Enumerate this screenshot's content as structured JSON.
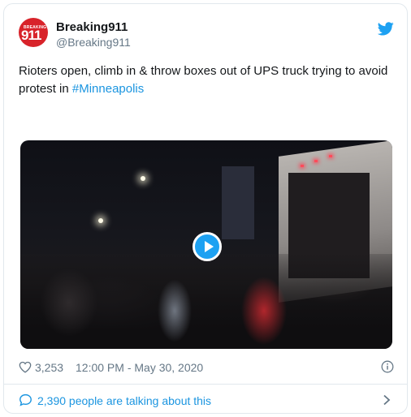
{
  "tweet": {
    "avatar": {
      "small_text": "BREAKING",
      "big_text": "911",
      "color": "#d8232a"
    },
    "display_name": "Breaking911",
    "handle": "@Breaking911",
    "text_before": "Rioters open, climb in & throw boxes out of UPS truck trying to avoid protest in ",
    "hashtag": "#Minneapolis",
    "media": {
      "type": "video",
      "play_icon": "play-icon"
    },
    "likes": "3,253",
    "timestamp": "12:00 PM - May 30, 2020",
    "conversation": "2,390 people are talking about this"
  },
  "icons": {
    "brand": "twitter-bird-icon",
    "like": "heart-icon",
    "info": "info-icon",
    "talk": "speech-bubble-icon",
    "more": "chevron-right-icon"
  },
  "colors": {
    "accent": "#1da1f2",
    "link": "#1b95e0",
    "muted": "#657786",
    "border": "#e1e8ed"
  }
}
